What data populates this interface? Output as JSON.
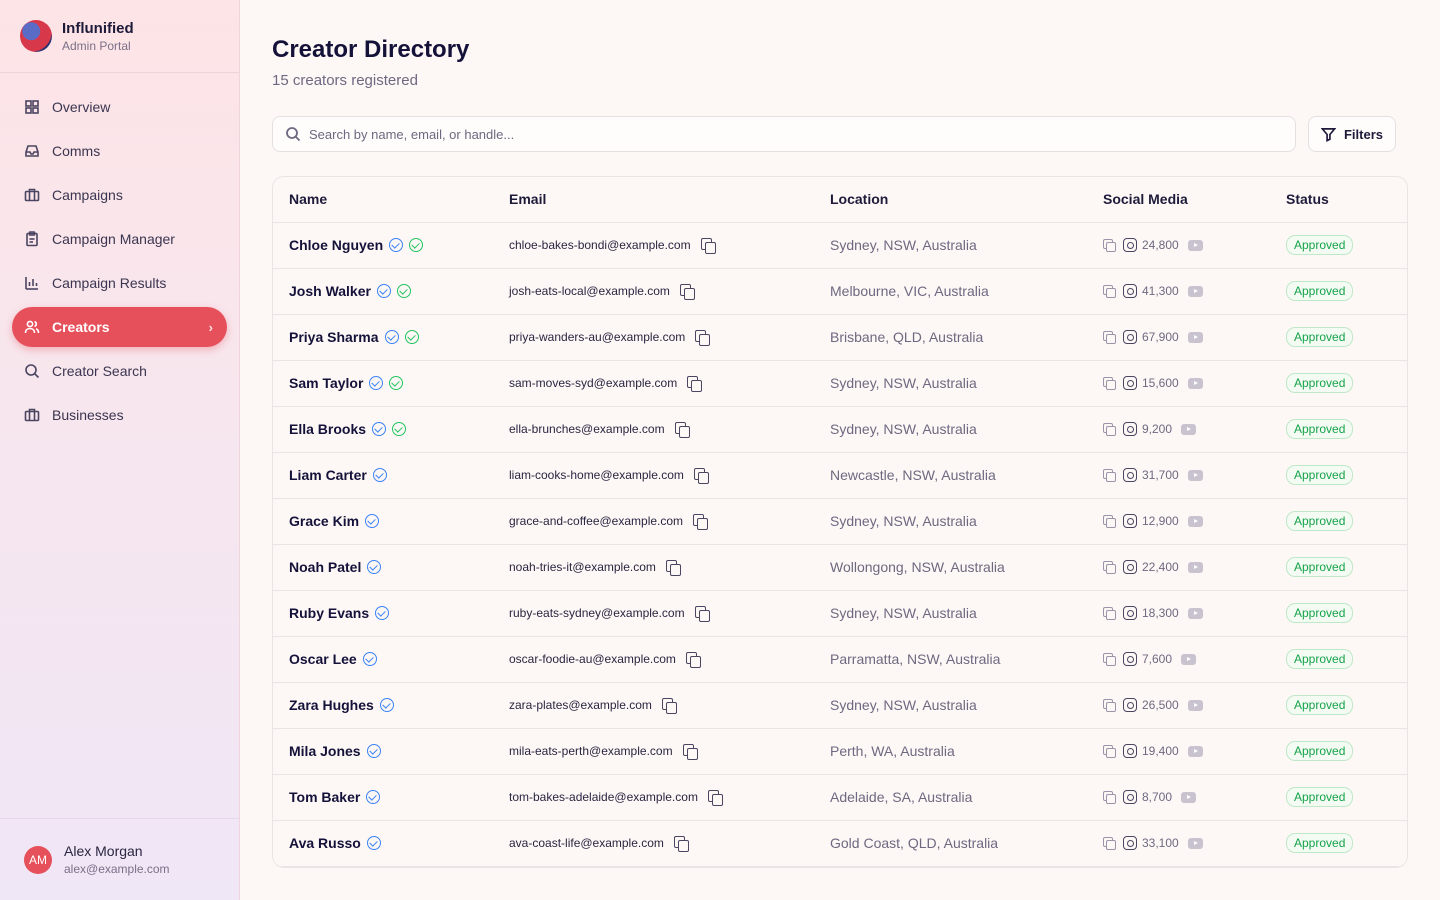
{
  "app": {
    "name": "Influnified",
    "subtitle": "Admin Portal"
  },
  "nav": [
    {
      "label": "Overview",
      "icon": "grid-icon"
    },
    {
      "label": "Comms",
      "icon": "inbox-icon"
    },
    {
      "label": "Campaigns",
      "icon": "briefcase-icon"
    },
    {
      "label": "Campaign Manager",
      "icon": "clipboard-icon"
    },
    {
      "label": "Campaign Results",
      "icon": "bar-chart-icon"
    },
    {
      "label": "Creators",
      "icon": "users-icon",
      "active": true
    },
    {
      "label": "Creator Search",
      "icon": "search-icon"
    },
    {
      "label": "Businesses",
      "icon": "briefcase-icon"
    }
  ],
  "user": {
    "initials": "AM",
    "name": "Alex Morgan",
    "email": "alex@example.com"
  },
  "page": {
    "title": "Creator Directory",
    "subtitle": "15 creators registered"
  },
  "search": {
    "placeholder": "Search by name, email, or handle..."
  },
  "filters_label": "Filters",
  "columns": [
    "Name",
    "Email",
    "Location",
    "Social Media",
    "Status"
  ],
  "rows": [
    {
      "name": "Chloe Nguyen",
      "email": "chloe-bakes-bondi@example.com",
      "location": "Sydney, NSW, Australia",
      "followers": "24,800",
      "status": "Approved",
      "green": true
    },
    {
      "name": "Josh Walker",
      "email": "josh-eats-local@example.com",
      "location": "Melbourne, VIC, Australia",
      "followers": "41,300",
      "status": "Approved",
      "green": true
    },
    {
      "name": "Priya Sharma",
      "email": "priya-wanders-au@example.com",
      "location": "Brisbane, QLD, Australia",
      "followers": "67,900",
      "status": "Approved",
      "green": true
    },
    {
      "name": "Sam Taylor",
      "email": "sam-moves-syd@example.com",
      "location": "Sydney, NSW, Australia",
      "followers": "15,600",
      "status": "Approved",
      "green": true
    },
    {
      "name": "Ella Brooks",
      "email": "ella-brunches@example.com",
      "location": "Sydney, NSW, Australia",
      "followers": "9,200",
      "status": "Approved",
      "green": true
    },
    {
      "name": "Liam Carter",
      "email": "liam-cooks-home@example.com",
      "location": "Newcastle, NSW, Australia",
      "followers": "31,700",
      "status": "Approved",
      "green": false
    },
    {
      "name": "Grace Kim",
      "email": "grace-and-coffee@example.com",
      "location": "Sydney, NSW, Australia",
      "followers": "12,900",
      "status": "Approved",
      "green": false
    },
    {
      "name": "Noah Patel",
      "email": "noah-tries-it@example.com",
      "location": "Wollongong, NSW, Australia",
      "followers": "22,400",
      "status": "Approved",
      "green": false
    },
    {
      "name": "Ruby Evans",
      "email": "ruby-eats-sydney@example.com",
      "location": "Sydney, NSW, Australia",
      "followers": "18,300",
      "status": "Approved",
      "green": false
    },
    {
      "name": "Oscar Lee",
      "email": "oscar-foodie-au@example.com",
      "location": "Parramatta, NSW, Australia",
      "followers": "7,600",
      "status": "Approved",
      "green": false
    },
    {
      "name": "Zara Hughes",
      "email": "zara-plates@example.com",
      "location": "Sydney, NSW, Australia",
      "followers": "26,500",
      "status": "Approved",
      "green": false
    },
    {
      "name": "Mila Jones",
      "email": "mila-eats-perth@example.com",
      "location": "Perth, WA, Australia",
      "followers": "19,400",
      "status": "Approved",
      "green": false
    },
    {
      "name": "Tom Baker",
      "email": "tom-bakes-adelaide@example.com",
      "location": "Adelaide, SA, Australia",
      "followers": "8,700",
      "status": "Approved",
      "green": false
    },
    {
      "name": "Ava Russo",
      "email": "ava-coast-life@example.com",
      "location": "Gold Coast, QLD, Australia",
      "followers": "33,100",
      "status": "Approved",
      "green": false
    }
  ]
}
